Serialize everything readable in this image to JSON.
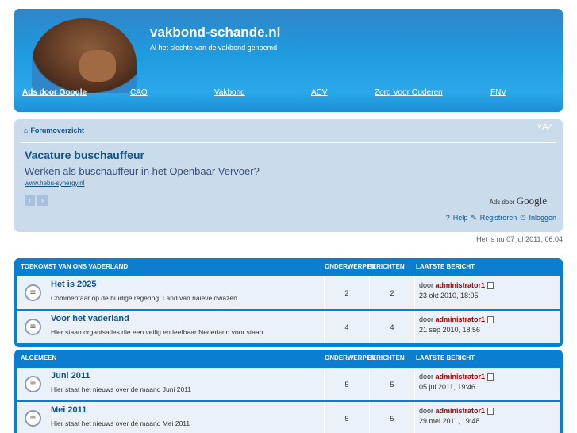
{
  "header": {
    "site_title": "vakbond-schande.nl",
    "site_description": "Al het slechte van de vakbond genoemd",
    "nav": [
      "Ads door Google",
      "CAO",
      "Vakbond",
      "ACV",
      "Zorg Voor Ouderen",
      "FNV"
    ]
  },
  "navbar": {
    "breadcrumb": "Forumoverzicht",
    "font_size_control": "˅A˄",
    "ad": {
      "title": "Vacature buschauffeur",
      "text": "Werken als buschauffeur in het Openbaar Vervoer?",
      "url": "www.hebu-synergy.nl",
      "ads_by_label": "Ads door",
      "ads_by_brand": "Google"
    },
    "links": {
      "help": "Help",
      "register": "Registreren",
      "login": "Inloggen"
    }
  },
  "datetime": "Het is nu 07 jul 2011, 06:04",
  "categories": [
    {
      "name": "TOEKOMST VAN ONS VADERLAND",
      "col_topics": "ONDERWERPEN",
      "col_posts": "BERICHTEN",
      "col_last": "LAATSTE BERICHT",
      "forums": [
        {
          "title": "Het is 2025",
          "desc": "Commentaar op de huidige regering. Land van naieve dwazen.",
          "topics": "2",
          "posts": "2",
          "by": "door",
          "author": "administrator1",
          "date": "23 okt 2010, 18:05"
        },
        {
          "title": "Voor het vaderland",
          "desc": "Hier staan organisaties die een veilig en leefbaar Nederland voor staan",
          "topics": "4",
          "posts": "4",
          "by": "door",
          "author": "administrator1",
          "date": "21 sep 2010, 18:56"
        }
      ]
    },
    {
      "name": "ALGEMEEN",
      "col_topics": "ONDERWERPEN",
      "col_posts": "BERICHTEN",
      "col_last": "LAATSTE BERICHT",
      "forums": [
        {
          "title": "Juni 2011",
          "desc": "Hier staat het nieuws over de maand Juni 2011",
          "topics": "5",
          "posts": "5",
          "by": "door",
          "author": "administrator1",
          "date": "05 jul 2011, 19:46"
        },
        {
          "title": "Mei 2011",
          "desc": "Hier staat het nieuws over de maand Mei 2011",
          "topics": "5",
          "posts": "5",
          "by": "door",
          "author": "administrator1",
          "date": "29 mei 2011, 19:48"
        }
      ]
    }
  ],
  "colors": {
    "header_blue": "#1f9be0",
    "category_blue": "#0b7ed0",
    "panel_bg": "#cadceb",
    "author_red": "#aa0000"
  }
}
